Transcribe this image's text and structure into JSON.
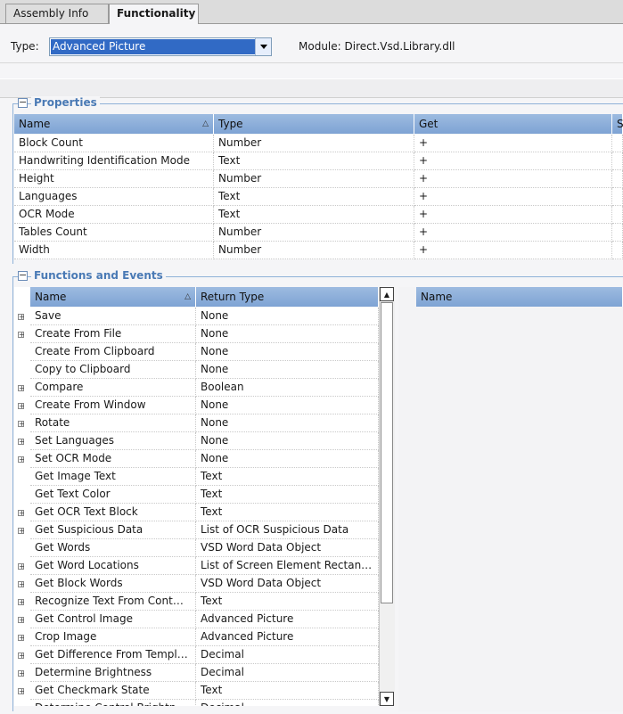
{
  "tabs": [
    "Assembly Info",
    "Functionality"
  ],
  "type_row": {
    "label": "Type:",
    "selected": "Advanced Picture",
    "module_label": "Module:",
    "module_value": "Direct.Vsd.Library.dll"
  },
  "properties": {
    "title": "Properties",
    "columns": [
      "Name",
      "Type",
      "Get",
      "S"
    ],
    "rows": [
      [
        "Block Count",
        "Number",
        "+"
      ],
      [
        "Handwriting Identification Mode",
        "Text",
        "+"
      ],
      [
        "Height",
        "Number",
        "+"
      ],
      [
        "Languages",
        "Text",
        "+"
      ],
      [
        "OCR Mode",
        "Text",
        "+"
      ],
      [
        "Tables Count",
        "Number",
        "+"
      ],
      [
        "Width",
        "Number",
        "+"
      ]
    ]
  },
  "functions": {
    "title": "Functions and Events",
    "columns": [
      "Name",
      "Return Type"
    ],
    "right_column": "Name",
    "rows": [
      {
        "name": "Save",
        "ret": "None",
        "exp": true
      },
      {
        "name": "Create From File",
        "ret": "None",
        "exp": true
      },
      {
        "name": "Create From Clipboard",
        "ret": "None",
        "exp": false
      },
      {
        "name": "Copy to Clipboard",
        "ret": "None",
        "exp": false
      },
      {
        "name": "Compare",
        "ret": "Boolean",
        "exp": true
      },
      {
        "name": "Create From Window",
        "ret": "None",
        "exp": true
      },
      {
        "name": "Rotate",
        "ret": "None",
        "exp": true
      },
      {
        "name": "Set Languages",
        "ret": "None",
        "exp": true
      },
      {
        "name": "Set OCR Mode",
        "ret": "None",
        "exp": true
      },
      {
        "name": "Get Image Text",
        "ret": "Text",
        "exp": false
      },
      {
        "name": "Get Text Color",
        "ret": "Text",
        "exp": false
      },
      {
        "name": "Get OCR Text Block",
        "ret": "Text",
        "exp": true
      },
      {
        "name": "Get Suspicious Data",
        "ret": "List of OCR Suspicious Data",
        "exp": true
      },
      {
        "name": "Get Words",
        "ret": "VSD Word Data Object",
        "exp": false
      },
      {
        "name": "Get Word Locations",
        "ret": "List of Screen Element Rectan…",
        "exp": true
      },
      {
        "name": "Get Block Words",
        "ret": "VSD Word Data Object",
        "exp": true
      },
      {
        "name": "Recognize Text From Cont…",
        "ret": "Text",
        "exp": true
      },
      {
        "name": "Get Control Image",
        "ret": "Advanced Picture",
        "exp": true
      },
      {
        "name": "Crop Image",
        "ret": "Advanced Picture",
        "exp": true
      },
      {
        "name": "Get Difference From Templ…",
        "ret": "Decimal",
        "exp": true
      },
      {
        "name": "Determine Brightness",
        "ret": "Decimal",
        "exp": true
      },
      {
        "name": "Get Checkmark State",
        "ret": "Text",
        "exp": true
      },
      {
        "name": "Determine Control Brightn…",
        "ret": "Decimal",
        "exp": true
      }
    ]
  }
}
